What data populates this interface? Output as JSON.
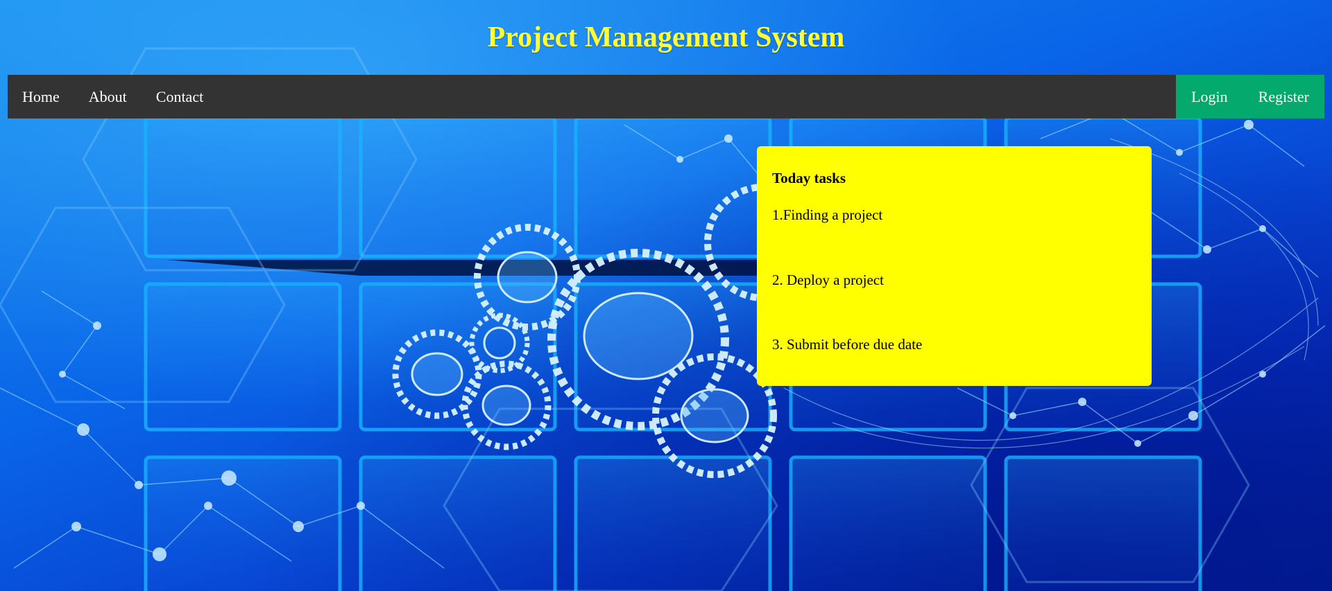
{
  "header": {
    "title": "Project Management System"
  },
  "nav": {
    "left": [
      {
        "label": "Home"
      },
      {
        "label": "About"
      },
      {
        "label": "Contact"
      }
    ],
    "right": [
      {
        "label": "Login"
      },
      {
        "label": "Register"
      }
    ]
  },
  "tasks_card": {
    "heading": "Today tasks",
    "items": [
      "1.Finding a project",
      "2. Deploy a project",
      "3. Submit before due date"
    ]
  },
  "colors": {
    "title": "#ffff33",
    "navbar": "#333333",
    "auth_area": "#04aa6d",
    "tasks_card": "#ffff00",
    "background": "#0a66e8"
  },
  "background_image": "gears-and-network-illustration"
}
